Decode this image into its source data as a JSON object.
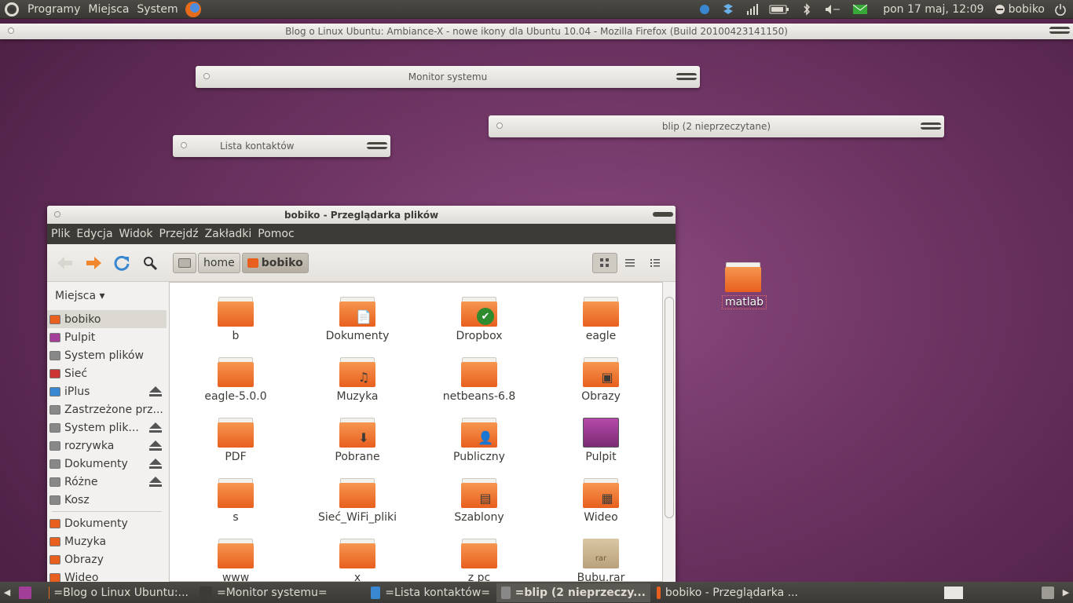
{
  "top_panel": {
    "menus": [
      "Programy",
      "Miejsca",
      "System"
    ],
    "clock": "pon 17 maj, 12:09",
    "user": "bobiko"
  },
  "windows": {
    "firefox_title": "Blog o Linux Ubuntu: Ambiance-X - nowe ikony dla Ubuntu 10.04 - Mozilla Firefox (Build 20100423141150)",
    "monitor_title": "Monitor systemu",
    "blip_title": "blip (2 nieprzeczytane)",
    "contacts_title": "Lista kontaktów"
  },
  "file_manager": {
    "title": "bobiko - Przeglądarka plików",
    "menu": [
      "Plik",
      "Edycja",
      "Widok",
      "Przejdź",
      "Zakładki",
      "Pomoc"
    ],
    "breadcrumbs": [
      "home",
      "bobiko"
    ],
    "sidebar_header": "Miejsca ▾",
    "places": [
      {
        "label": "bobiko",
        "selected": true
      },
      {
        "label": "Pulpit"
      },
      {
        "label": "System plików"
      },
      {
        "label": "Sieć"
      },
      {
        "label": "iPlus",
        "eject": true
      },
      {
        "label": "Zastrzeżone prz..."
      },
      {
        "label": "System plik...",
        "eject": true
      },
      {
        "label": "rozrywka",
        "eject": true
      },
      {
        "label": "Dokumenty",
        "eject": true
      },
      {
        "label": "Różne",
        "eject": true
      },
      {
        "label": "Kosz"
      }
    ],
    "bookmarks": [
      "Dokumenty",
      "Muzyka",
      "Obrazy",
      "Wideo"
    ],
    "files": [
      [
        "b",
        "Dokumenty",
        "Dropbox",
        "eagle"
      ],
      [
        "eagle-5.0.0",
        "Muzyka",
        "netbeans-6.8",
        "Obrazy"
      ],
      [
        "PDF",
        "Pobrane",
        "Publiczny",
        "Pulpit"
      ],
      [
        "s",
        "Sieć_WiFi_pliki",
        "Szablony",
        "Wideo"
      ],
      [
        "www",
        "x",
        "z pc",
        "Bubu.rar"
      ]
    ]
  },
  "desktop": {
    "folder": "matlab"
  },
  "taskbar": [
    "=Blog o Linux Ubuntu:...",
    "=Monitor systemu=",
    "=Lista kontaktów=",
    "=blip (2 nieprzeczy...",
    "bobiko - Przeglądarka ..."
  ]
}
